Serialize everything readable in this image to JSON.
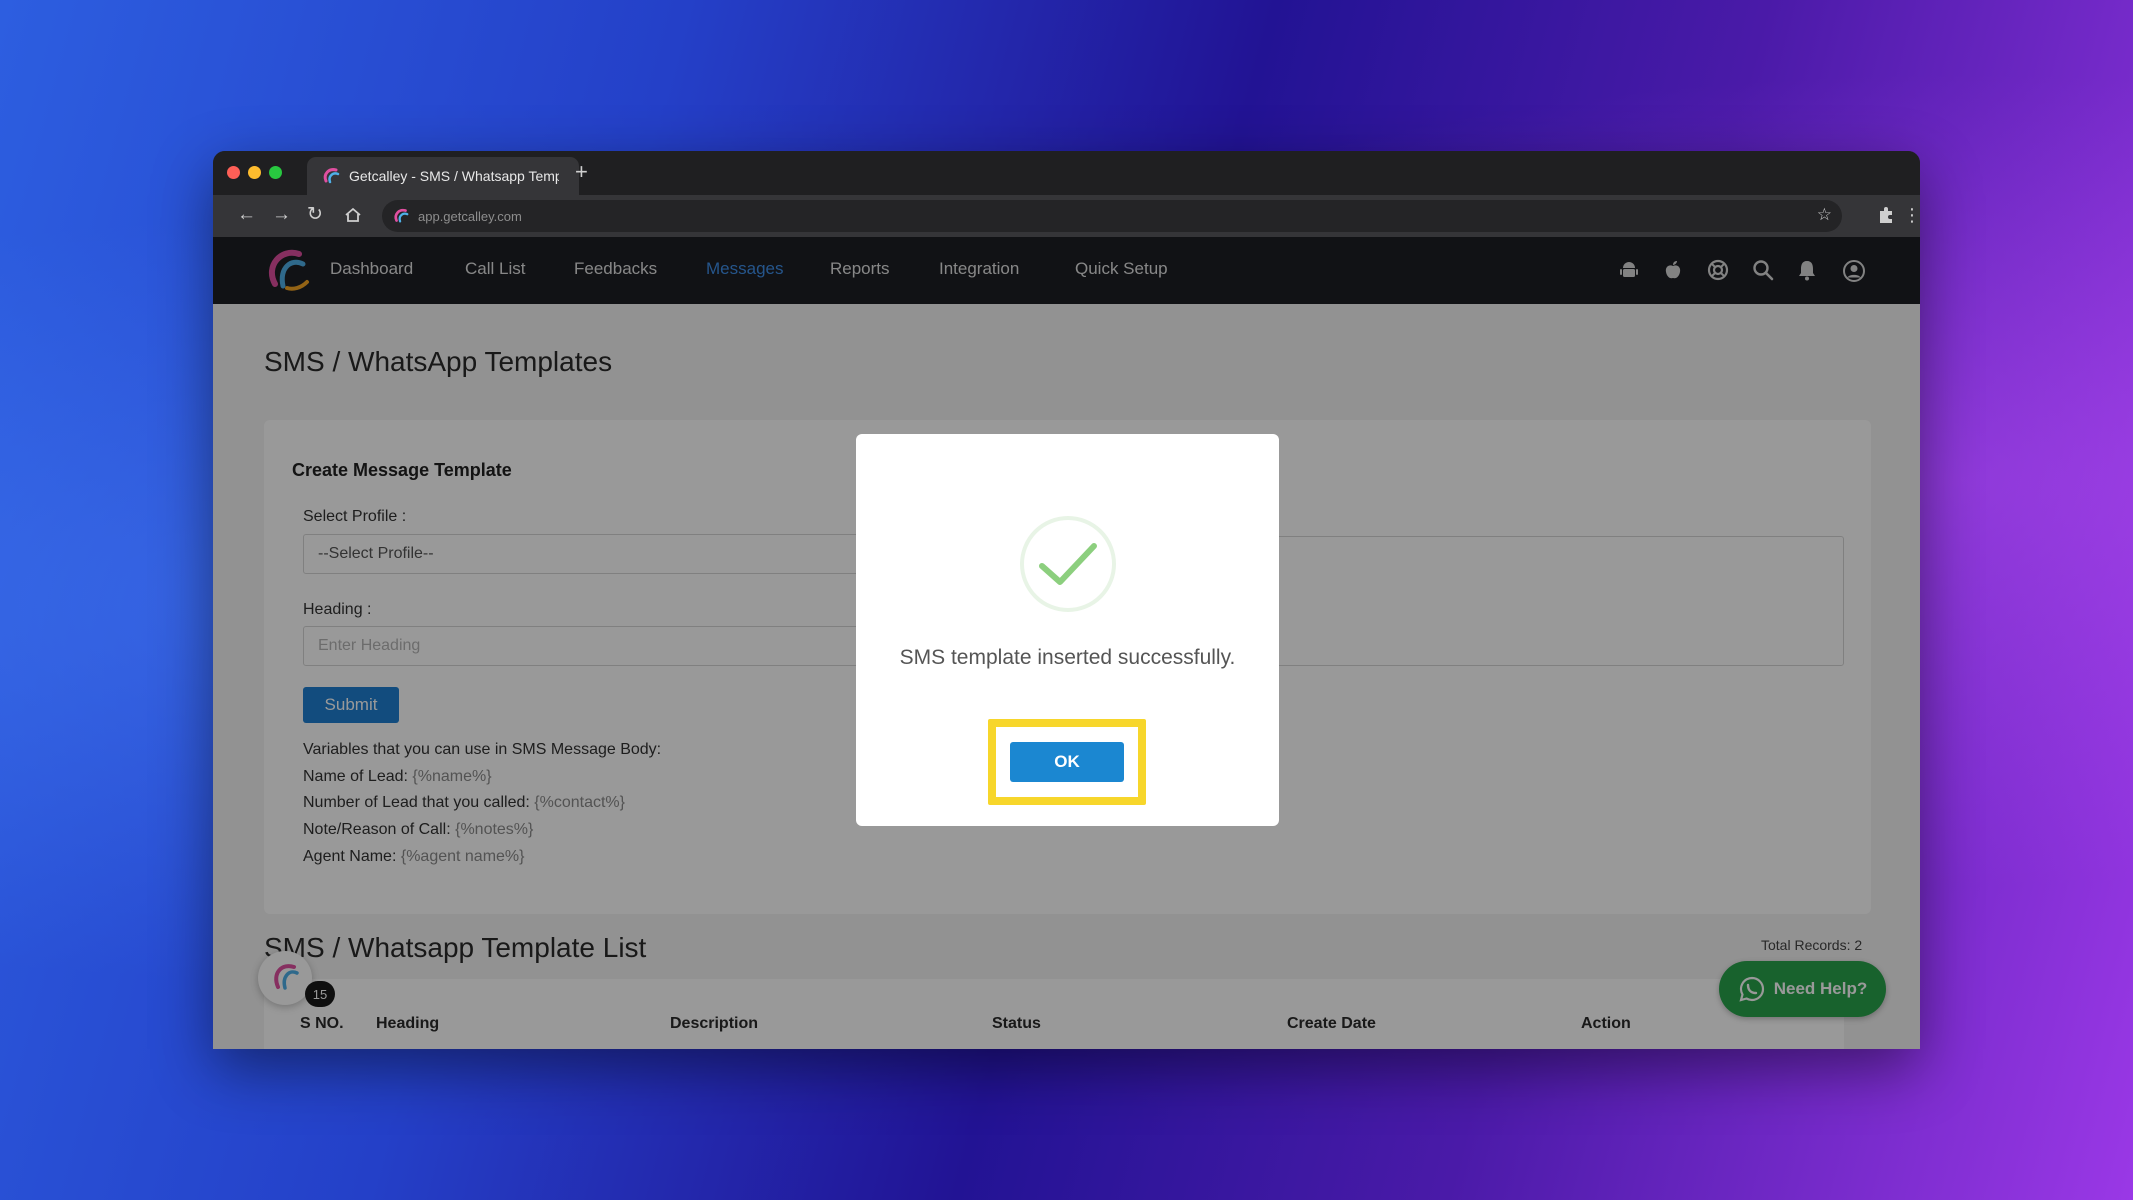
{
  "browser": {
    "tab_title": "Getcalley - SMS / Whatsapp Temp",
    "new_tab": "+",
    "url": "app.getcalley.com"
  },
  "nav": {
    "items": [
      {
        "label": "Dashboard"
      },
      {
        "label": "Call List"
      },
      {
        "label": "Feedbacks"
      },
      {
        "label": "Messages"
      },
      {
        "label": "Reports"
      },
      {
        "label": "Integration"
      },
      {
        "label": "Quick Setup"
      }
    ],
    "active": "Messages",
    "icons": [
      "android-icon",
      "apple-icon",
      "support-icon",
      "search-icon",
      "bell-icon",
      "user-icon"
    ]
  },
  "page": {
    "title": "SMS / WhatsApp Templates"
  },
  "form": {
    "title": "Create Message Template",
    "profile_label": "Select Profile :",
    "profile_value": "--Select Profile--",
    "heading_label": "Heading :",
    "heading_placeholder": "Enter Heading",
    "submit_label": "Submit",
    "variables_intro": "Variables that you can use in SMS Message Body:",
    "variables": [
      {
        "label": "Name of Lead:",
        "code": "{%name%}"
      },
      {
        "label": "Number of Lead that you called:",
        "code": "{%contact%}"
      },
      {
        "label": "Note/Reason of Call:",
        "code": "{%notes%}"
      },
      {
        "label": "Agent Name:",
        "code": "{%agent name%}"
      }
    ]
  },
  "list": {
    "title": "SMS / Whatsapp Template List",
    "total_records": "Total Records: 2",
    "columns": [
      "S NO.",
      "Heading",
      "Description",
      "Status",
      "Create Date",
      "Action"
    ]
  },
  "chat": {
    "badge_count": "15",
    "help_label": "Need Help?"
  },
  "modal": {
    "message": "SMS template inserted successfully.",
    "ok_label": "OK"
  },
  "colors": {
    "nav_bg": "#1d1f24",
    "nav_active": "#3f8ee8",
    "primary_button": "#1b87d1",
    "success_check": "#8ccf7e",
    "highlight": "#f7d62b",
    "help_button": "#28a44c"
  }
}
